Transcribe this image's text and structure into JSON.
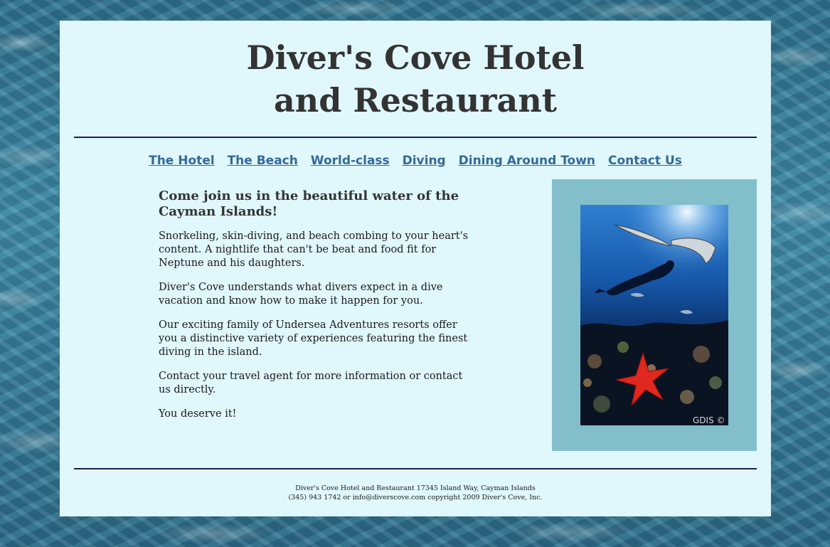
{
  "header": {
    "title_line1": "Diver's Cove Hotel",
    "title_line2": "and Restaurant"
  },
  "nav": {
    "items": [
      {
        "label": "The Hotel"
      },
      {
        "label": "The Beach"
      },
      {
        "label": "World-class"
      },
      {
        "label": "Diving"
      },
      {
        "label": "Dining Around Town"
      },
      {
        "label": "Contact Us"
      }
    ]
  },
  "main": {
    "heading": "Come join us in the beautiful water of the Cayman Islands!",
    "paragraphs": [
      "Snorkeling, skin-diving, and beach combing to your heart's content. A nightlife that can't be beat and food fit for Neptune and his daughters.",
      "Diver's Cove understands what divers expect in a dive vacation and know how to make it happen for you.",
      "Our exciting family of Undersea Adventures resorts offer you a distinctive variety of experiences featuring the finest diving in the island.",
      "Contact your travel agent for more information or contact us directly.",
      "You deserve it!"
    ]
  },
  "image": {
    "credit": "GDIS ©"
  },
  "footer": {
    "line1": "Diver's Cove Hotel and Restaurant 17345 Island Way, Cayman Islands",
    "line2": "(345) 943 1742 or info@diverscove.com copyright 2009 Diver's Cove, Inc."
  },
  "colors": {
    "page_background": "#e0f7fc",
    "nav_link": "#336a99",
    "rule": "#1e1e4e",
    "image_frame": "#82bfcb"
  }
}
